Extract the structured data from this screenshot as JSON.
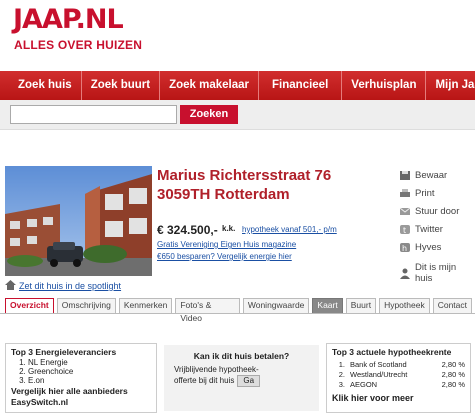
{
  "brand": {
    "logo": "JAAP.NL",
    "tagline": "ALLES OVER HUIZEN",
    "accent": "#c8102e"
  },
  "nav": [
    "Zoek huis",
    "Zoek buurt",
    "Zoek makelaar",
    "Financieel",
    "Verhuisplan",
    "Mijn Jaap"
  ],
  "search": {
    "value": "",
    "button": "Zoeken"
  },
  "listing": {
    "street": "Marius Richtersstraat 76",
    "city": "3059TH Rotterdam",
    "price": "€ 324.500,-",
    "price_suffix": "k.k.",
    "mortgage_link": "hypotheek vanaf 501,- p/m",
    "magazine_link": "Gratis Vereniging Eigen Huis magazine",
    "energy_link": "€650 besparen? Vergelijk energie hier"
  },
  "actions": [
    {
      "label": "Bewaar",
      "icon": "save-icon"
    },
    {
      "label": "Print",
      "icon": "printer-icon"
    },
    {
      "label": "Stuur door",
      "icon": "mail-icon"
    },
    {
      "label": "Twitter",
      "icon": "twitter-icon"
    },
    {
      "label": "Hyves",
      "icon": "hyves-icon"
    },
    {
      "label": "Dit is mijn huis",
      "icon": "person-icon"
    }
  ],
  "spotlight_link": "Zet dit huis in de spotlight",
  "tabs": [
    "Overzicht",
    "Omschrijving",
    "Kenmerken",
    "Foto's & Video",
    "Woningwaarde",
    "Kaart",
    "Buurt",
    "Hypotheek",
    "Contact"
  ],
  "energy_box": {
    "title": "Top 3 Energieleveranciers",
    "items": [
      "NL Energie",
      "Greenchoice",
      "E.on"
    ],
    "compare": "Vergelijk hier alle aanbieders",
    "site": "EasySwitch.nl"
  },
  "afford_box": {
    "title": "Kan ik dit huis betalen?",
    "line1": "Vrijblijvende hypotheek-",
    "line2": "offerte bij dit huis",
    "button": "Ga"
  },
  "mortgage_box": {
    "title": "Top 3 actuele hypotheekrente",
    "rows": [
      {
        "n": "1.",
        "bank": "Bank of Scotland",
        "rate": "2,80 %"
      },
      {
        "n": "2.",
        "bank": "Westland/Utrecht",
        "rate": "2,80 %"
      },
      {
        "n": "3.",
        "bank": "AEGON",
        "rate": "2,80 %"
      }
    ],
    "more": "Klik hier voor meer"
  }
}
